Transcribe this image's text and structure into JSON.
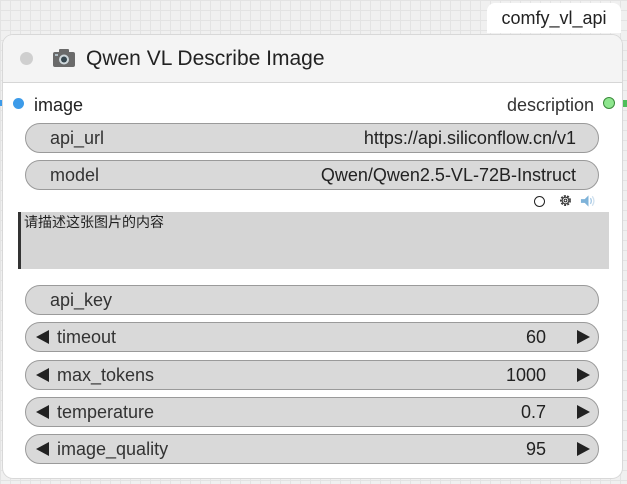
{
  "group_badge": "comfy_vl_api",
  "node": {
    "title": "Qwen VL Describe Image",
    "title_icon": "camera-icon",
    "input_slot": {
      "label": "image",
      "color": "#3d9be9"
    },
    "output_slot": {
      "label": "description",
      "color": "#8ee68e"
    }
  },
  "widgets": {
    "api_url": {
      "name": "api_url",
      "value": "https://api.siliconflow.cn/v1"
    },
    "model": {
      "name": "model",
      "value": "Qwen/Qwen2.5-VL-72B-Instruct"
    },
    "prompt": {
      "value": "请描述这张图片的内容"
    },
    "api_key": {
      "name": "api_key",
      "value": ""
    },
    "timeout": {
      "name": "timeout",
      "value": "60"
    },
    "max_tokens": {
      "name": "max_tokens",
      "value": "1000"
    },
    "temperature": {
      "name": "temperature",
      "value": "0.7"
    },
    "image_quality": {
      "name": "image_quality",
      "value": "95"
    }
  },
  "prompt_toolbar": {
    "icons": [
      "circle-icon",
      "gear-icon",
      "speaker-icon"
    ]
  }
}
